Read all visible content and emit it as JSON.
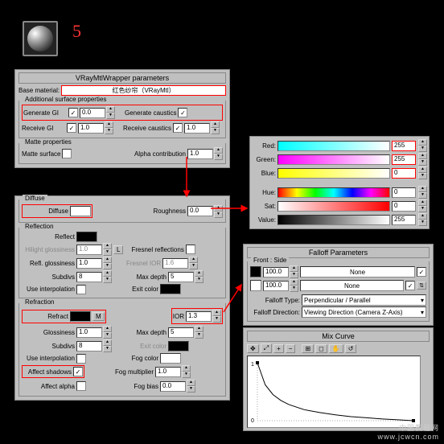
{
  "step_number": "5",
  "wrapper": {
    "title": "VRayMtlWrapper parameters",
    "base_material_label": "Base material:",
    "base_material_value": "红色纱帘（VRayMtl）",
    "surface_group": "Additional surface properties",
    "generate_gi": "Generate GI",
    "generate_gi_val": "0.0",
    "receive_gi": "Receive GI",
    "receive_gi_val": "1.0",
    "generate_caustics": "Generate caustics",
    "receive_caustics": "Receive caustics",
    "receive_caustics_val": "1.0",
    "matte_group": "Matte properties",
    "matte_surface": "Matte surface",
    "alpha_contrib": "Alpha contribution",
    "alpha_contrib_val": "1.0"
  },
  "diffuse": {
    "group": "Diffuse",
    "diffuse_label": "Diffuse",
    "roughness_label": "Roughness",
    "roughness_val": "0.0"
  },
  "reflection": {
    "group": "Reflection",
    "reflect_label": "Reflect",
    "hilight_gloss": "Hilight glossiness",
    "hilight_gloss_val": "1.0",
    "hilight_lock": "L",
    "refl_gloss": "Refl. glossiness",
    "refl_gloss_val": "1.0",
    "subdivs": "Subdivs",
    "subdivs_val": "8",
    "interp": "Use interpolation",
    "fresnel": "Fresnel reflections",
    "fresnel_ior": "Fresnel IOR",
    "fresnel_ior_val": "1.6",
    "max_depth": "Max depth",
    "max_depth_val": "5",
    "exit_color": "Exit color"
  },
  "refraction": {
    "group": "Refraction",
    "refract_label": "Refract",
    "m_btn": "M",
    "ior": "IOR",
    "ior_val": "1.3",
    "gloss": "Glossiness",
    "gloss_val": "1.0",
    "subdivs": "Subdivs",
    "subdivs_val": "8",
    "interp": "Use interpolation",
    "affect_shadows": "Affect shadows",
    "affect_alpha": "Affect alpha",
    "max_depth": "Max depth",
    "max_depth_val": "5",
    "exit_color": "Exit color",
    "fog_color": "Fog color",
    "fog_mult": "Fog multiplier",
    "fog_mult_val": "1.0",
    "fog_bias": "Fog bias",
    "fog_bias_val": "0.0"
  },
  "color": {
    "red": "Red:",
    "red_val": "255",
    "green": "Green:",
    "green_val": "255",
    "blue": "Blue:",
    "blue_val": "0",
    "hue": "Hue:",
    "hue_val": "0",
    "sat": "Sat:",
    "sat_val": "0",
    "value": "Value:",
    "value_val": "255"
  },
  "falloff": {
    "title": "Falloff Parameters",
    "front_side": "Front : Side",
    "val1": "100.0",
    "none": "None",
    "val2": "100.0",
    "type_label": "Falloff Type:",
    "type_val": "Perpendicular / Parallel",
    "dir_label": "Falloff Direction:",
    "dir_val": "Viewing Direction (Camera Z-Axis)"
  },
  "mixcurve": {
    "title": "Mix Curve"
  },
  "chart_data": {
    "type": "line",
    "title": "Mix Curve",
    "xlabel": "",
    "ylabel": "",
    "xlim": [
      0,
      1
    ],
    "ylim": [
      0,
      1
    ],
    "x": [
      0,
      0.05,
      0.1,
      0.15,
      0.2,
      0.3,
      0.4,
      0.5,
      0.6,
      0.7,
      0.8,
      0.9,
      1.0
    ],
    "values": [
      1.0,
      0.62,
      0.45,
      0.35,
      0.28,
      0.19,
      0.14,
      0.1,
      0.07,
      0.05,
      0.03,
      0.015,
      0.0
    ]
  },
  "watermark": {
    "line1": "中国教程网",
    "line2": "www.jcwcn.com"
  }
}
